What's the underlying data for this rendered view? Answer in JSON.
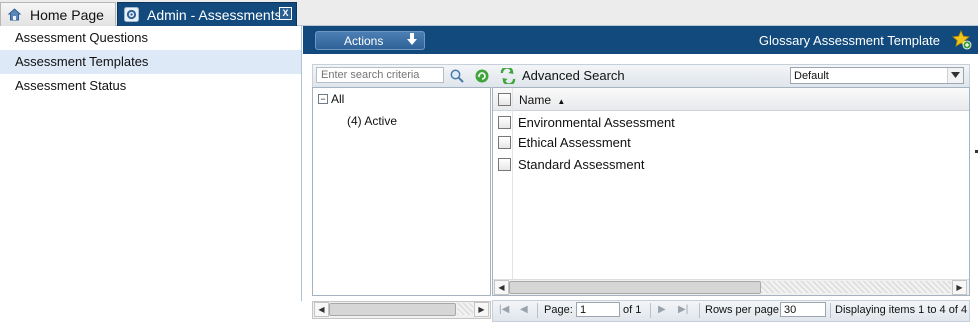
{
  "tabs": [
    {
      "label": "Home Page",
      "active": false,
      "icon": "home-icon"
    },
    {
      "label": "Admin - Assessments",
      "active": true,
      "icon": "gear-icon",
      "close": "X"
    }
  ],
  "leftnav": {
    "items": [
      {
        "label": "Assessment Questions",
        "selected": false
      },
      {
        "label": "Assessment Templates",
        "selected": true
      },
      {
        "label": "Assessment Status",
        "selected": false
      }
    ]
  },
  "header": {
    "actions_label": "Actions",
    "title": "Glossary Assessment Template"
  },
  "toolbar": {
    "search_placeholder": "Enter search criteria",
    "advanced_search_label": "Advanced Search",
    "view_value": "Default"
  },
  "tree": {
    "root_label": "All",
    "root_expander": "−",
    "child_label": "(4) Active"
  },
  "grid": {
    "column_name": "Name",
    "sort_indicator": "▲",
    "rows": [
      {
        "name": "Environmental Assessment"
      },
      {
        "name": "Ethical Assessment"
      },
      {
        "name": "Standard Assessment"
      }
    ]
  },
  "pager": {
    "page_label": "Page:",
    "page_value": "1",
    "of_label": "of 1",
    "rows_per_page_label": "Rows per page",
    "rows_per_page_value": "30",
    "display_text": "Displaying items 1 to 4 of 4"
  },
  "colors": {
    "header_bg": "#124a7d",
    "nav_selected_bg": "#dde9f6",
    "accent": "#2f6298"
  }
}
